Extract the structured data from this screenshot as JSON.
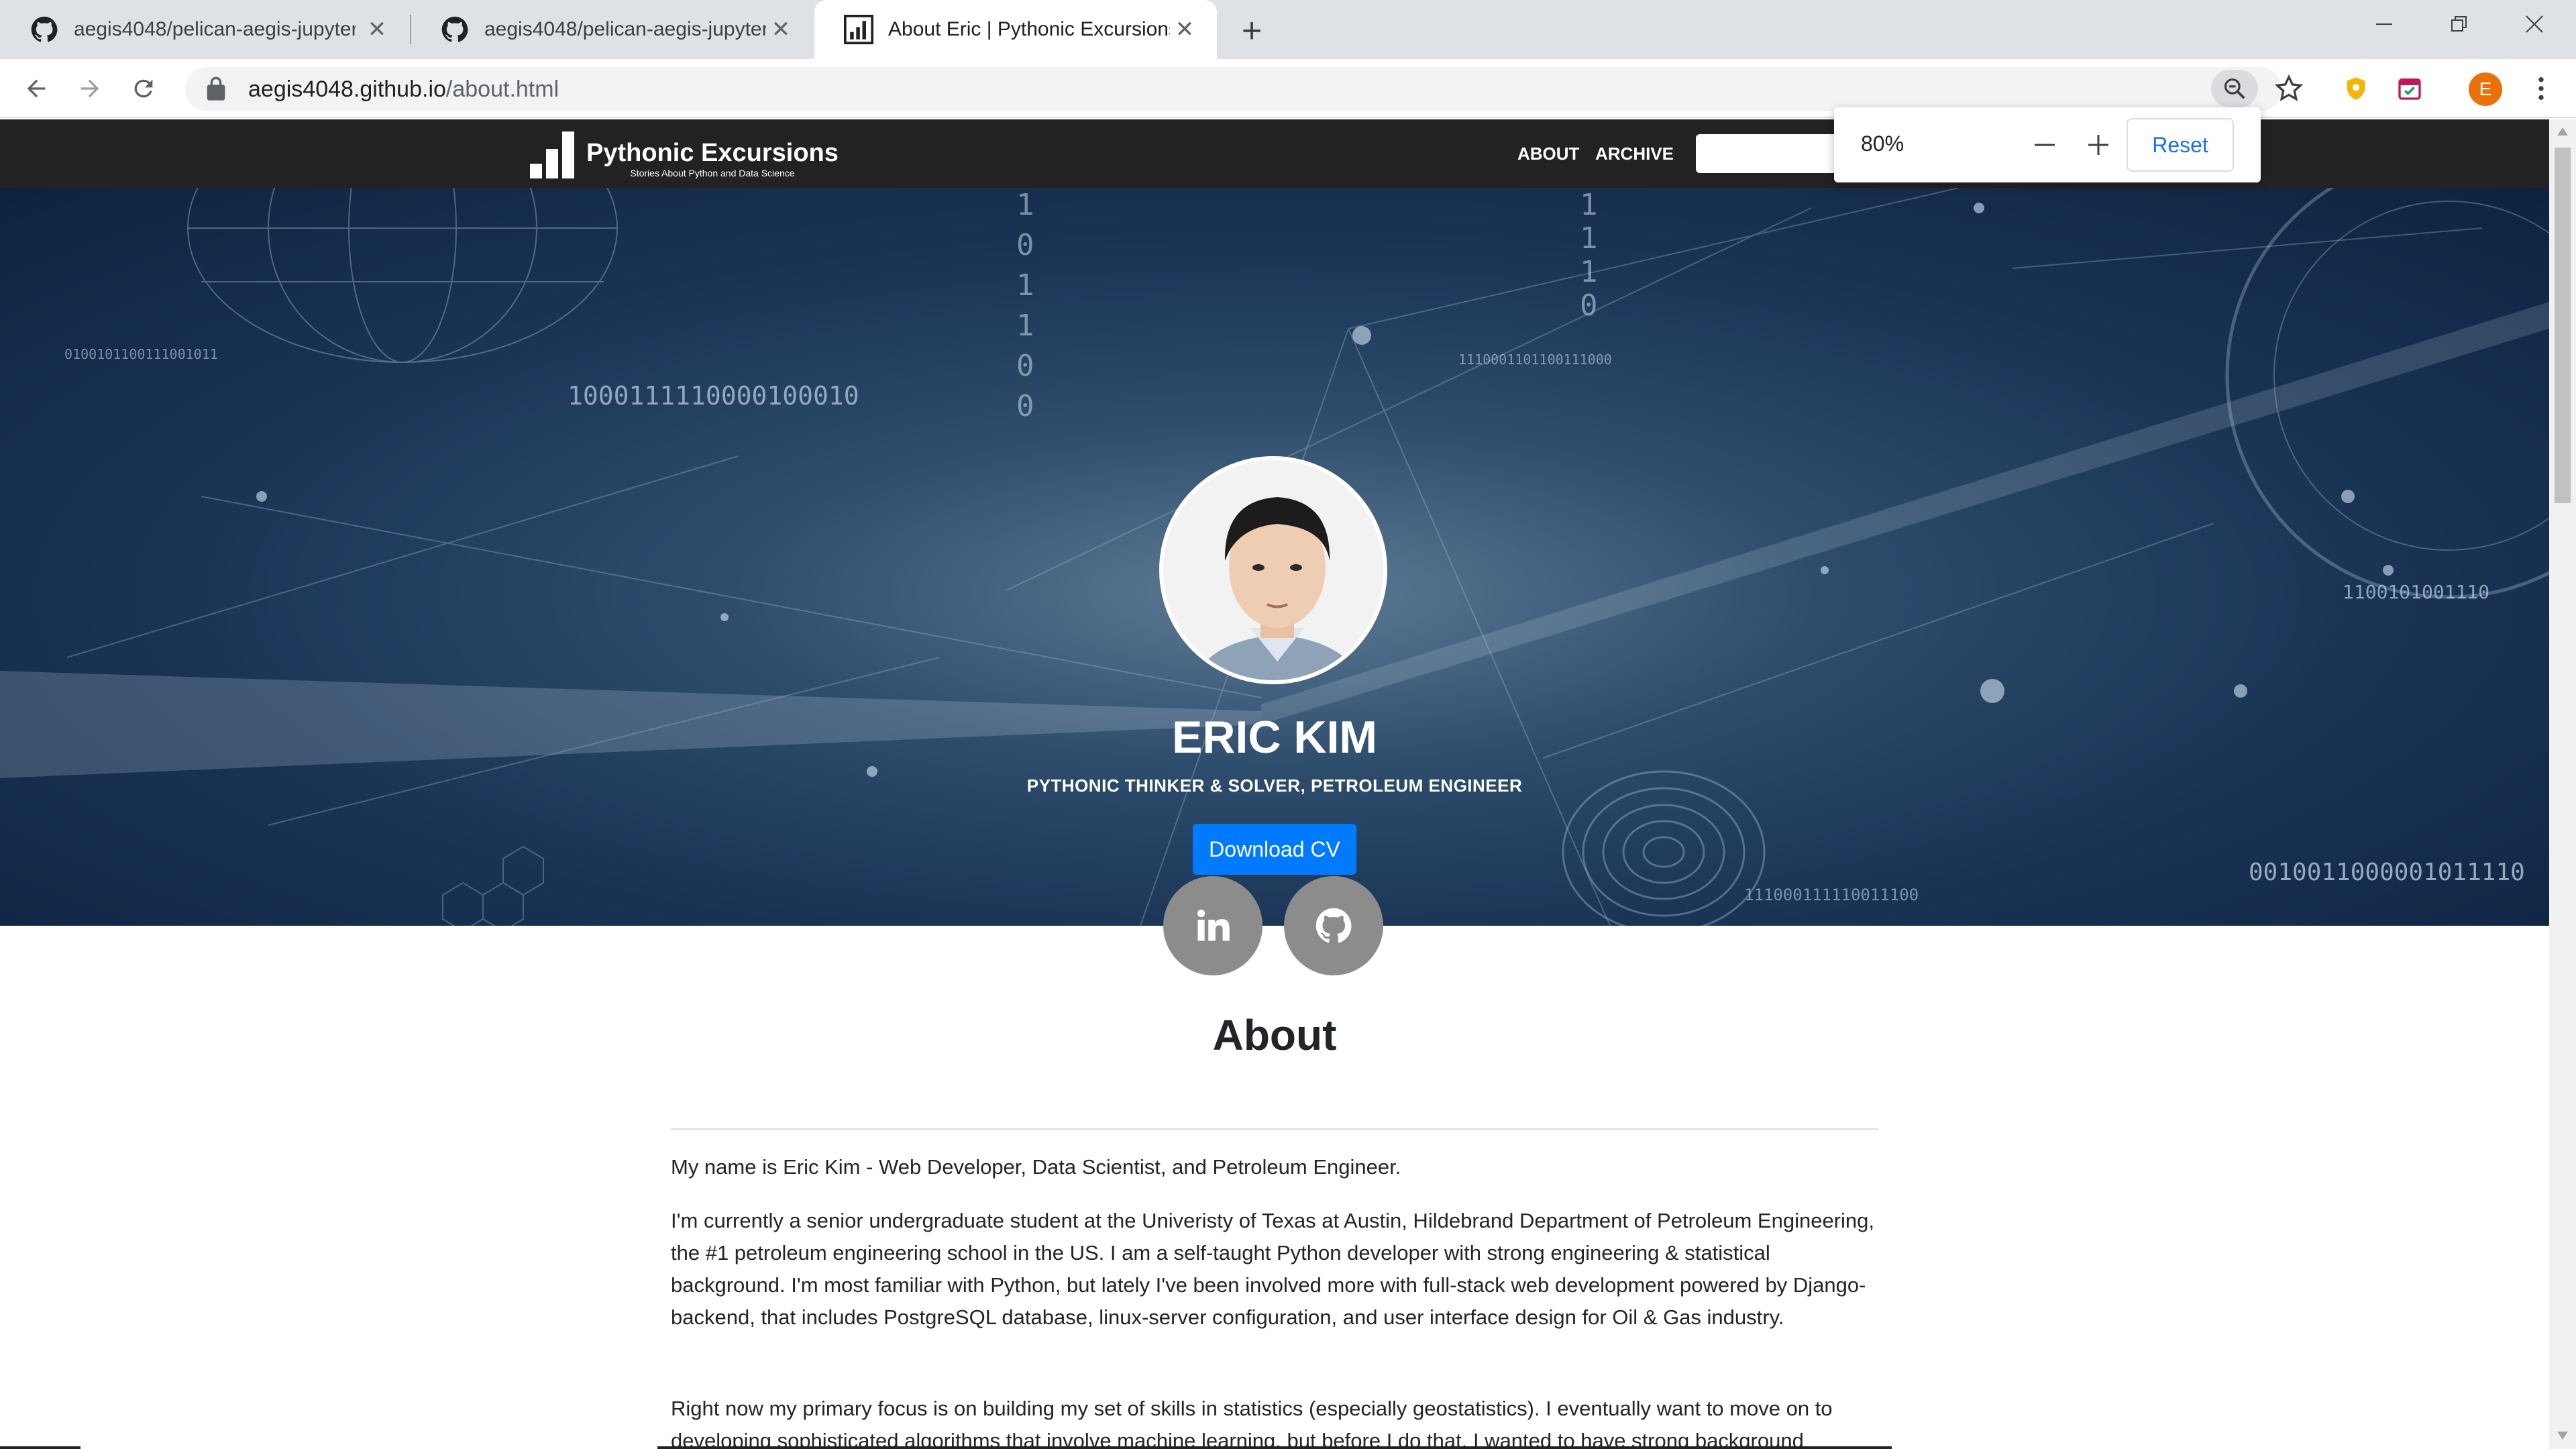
{
  "browser": {
    "tabs": [
      {
        "title": "aegis4048/pelican-aegis-jupyter-",
        "icon": "github-icon"
      },
      {
        "title": "aegis4048/pelican-aegis-jupyter-",
        "icon": "github-icon"
      },
      {
        "title": "About Eric | Pythonic Excursions",
        "icon": "site-favicon",
        "active": true
      }
    ],
    "url_host": "aegis4048.github.io",
    "url_path": "/about.html",
    "profile_initial": "E",
    "zoom": {
      "value": "80%",
      "reset_label": "Reset"
    }
  },
  "site": {
    "brand_name": "Pythonic Excursions",
    "brand_tagline": "Stories About Python and Data Science",
    "nav": {
      "about": "ABOUT",
      "archive": "ARCHIVE"
    }
  },
  "hero": {
    "name": "ERIC KIM",
    "subtitle": "PYTHONIC THINKER & SOLVER, PETROLEUM ENGINEER",
    "cv_label": "Download CV",
    "binary_strings": [
      "1000111110000100010",
      "0100101100111001011",
      "1100101001110",
      "0010011000001011110",
      "111000111110011100",
      "1110001101100111000"
    ]
  },
  "about": {
    "title": "About",
    "paragraphs": [
      "My name is Eric Kim - Web Developer, Data Scientist, and Petroleum Engineer.",
      "I'm currently a senior undergraduate student at the Univeristy of Texas at Austin, Hildebrand Department of Petroleum Engineering, the #1 petroleum engineering school in the US. I am a self-taught Python developer with strong engineering & statistical background. I'm most familiar with Python, but lately I've been involved more with full-stack web development powered by Django-backend, that includes PostgreSQL database, linux-server configuration, and user interface design for Oil & Gas industry.",
      "Right now my primary focus is on building my set of skills in statistics (especially geostatistics). I eventually want to move on to developing sophisticated algorithms that involve machine learning, but before I do that, I wanted to have strong background"
    ]
  },
  "colors": {
    "accent": "#007bff",
    "navbar": "#222222",
    "hero_dark": "#0e2240"
  }
}
